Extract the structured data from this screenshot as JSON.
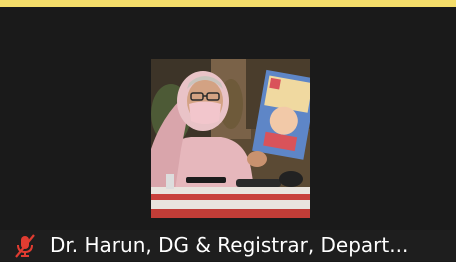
{
  "participant": {
    "display_name": "Dr. Harun, DG & Registrar, Depart..."
  },
  "tile": {
    "active_speaker": true,
    "muted": true
  },
  "icons": {
    "mic": "mic-off-icon"
  },
  "colors": {
    "background": "#1a1a1a",
    "active_border": "#f4dd6a",
    "muted_icon": "#e03c31",
    "name_text": "#ffffff"
  }
}
